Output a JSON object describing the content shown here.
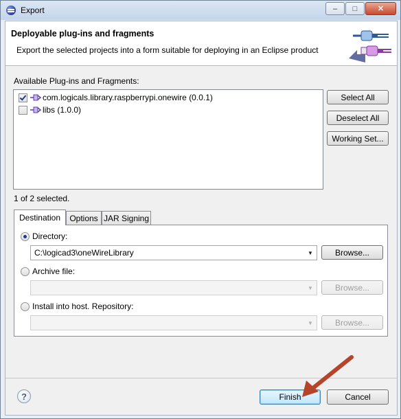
{
  "window": {
    "title": "Export",
    "minimize_glyph": "–",
    "maximize_glyph": "□",
    "close_glyph": "✕"
  },
  "header": {
    "title": "Deployable plug-ins and fragments",
    "description": "Export the selected projects into a form suitable for deploying in an Eclipse product",
    "graphic_icon": "plugin-export-wizard-icon"
  },
  "plugins": {
    "label": "Available Plug-ins and Fragments:",
    "items": [
      {
        "label": "com.logicals.library.raspberrypi.onewire (0.0.1)",
        "checked": true,
        "icon": "plugin-icon"
      },
      {
        "label": "libs (1.0.0)",
        "checked": false,
        "icon": "plugin-icon"
      }
    ],
    "select_all_label": "Select All",
    "deselect_all_label": "Deselect All",
    "working_set_label": "Working Set...",
    "selected_count": "1 of 2 selected."
  },
  "tabs": [
    {
      "label": "Destination",
      "active": true
    },
    {
      "label": "Options",
      "active": false
    },
    {
      "label": "JAR Signing",
      "active": false
    }
  ],
  "destination": {
    "directory": {
      "label": "Directory:",
      "selected": true,
      "value": "C:\\logicad3\\oneWireLibrary",
      "browse_label": "Browse...",
      "enabled": true
    },
    "archive": {
      "label": "Archive file:",
      "selected": false,
      "value": "",
      "browse_label": "Browse...",
      "enabled": false
    },
    "install": {
      "label": "Install into host. Repository:",
      "selected": false,
      "value": "",
      "browse_label": "Browse...",
      "enabled": false
    }
  },
  "footer": {
    "help_glyph": "?",
    "finish_label": "Finish",
    "cancel_label": "Cancel"
  },
  "colors": {
    "annotation_arrow": "#b5442b",
    "default_button_border": "#3c7fb1"
  }
}
